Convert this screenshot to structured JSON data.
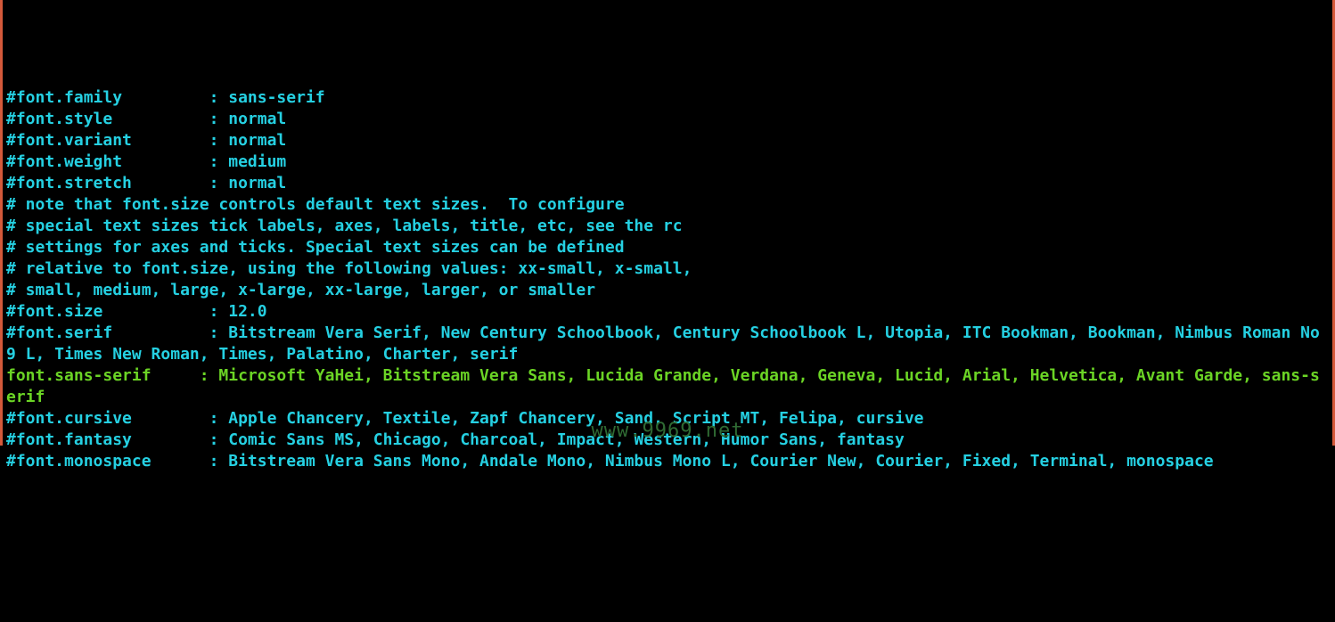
{
  "config": {
    "lines": [
      {
        "cls": "cyan",
        "text": "#font.family         : sans-serif"
      },
      {
        "cls": "cyan",
        "text": "#font.style          : normal"
      },
      {
        "cls": "cyan",
        "text": "#font.variant        : normal"
      },
      {
        "cls": "cyan",
        "text": "#font.weight         : medium"
      },
      {
        "cls": "cyan",
        "text": "#font.stretch        : normal"
      },
      {
        "cls": "cyan",
        "text": "# note that font.size controls default text sizes.  To configure"
      },
      {
        "cls": "cyan",
        "text": "# special text sizes tick labels, axes, labels, title, etc, see the rc"
      },
      {
        "cls": "cyan",
        "text": "# settings for axes and ticks. Special text sizes can be defined"
      },
      {
        "cls": "cyan",
        "text": "# relative to font.size, using the following values: xx-small, x-small,"
      },
      {
        "cls": "cyan",
        "text": "# small, medium, large, x-large, xx-large, larger, or smaller"
      },
      {
        "cls": "cyan",
        "text": "#font.size           : 12.0"
      },
      {
        "cls": "cyan",
        "text": "#font.serif          : Bitstream Vera Serif, New Century Schoolbook, Century Schoolbook L, Utopia, ITC Bookman, Bookman, Nimbus Roman No9 L, Times New Roman, Times, Palatino, Charter, serif"
      },
      {
        "cls": "green",
        "text": "font.sans-serif     : Microsoft YaHei, Bitstream Vera Sans, Lucida Grande, Verdana, Geneva, Lucid, Arial, Helvetica, Avant Garde, sans-serif"
      },
      {
        "cls": "cyan",
        "text": "#font.cursive        : Apple Chancery, Textile, Zapf Chancery, Sand, Script MT, Felipa, cursive"
      },
      {
        "cls": "cyan",
        "text": "#font.fantasy        : Comic Sans MS, Chicago, Charcoal, Impact, Western, Humor Sans, fantasy"
      },
      {
        "cls": "cyan",
        "text": "#font.monospace      : Bitstream Vera Sans Mono, Andale Mono, Nimbus Mono L, Courier New, Courier, Fixed, Terminal, monospace"
      }
    ]
  },
  "watermark": "www.9969.net"
}
